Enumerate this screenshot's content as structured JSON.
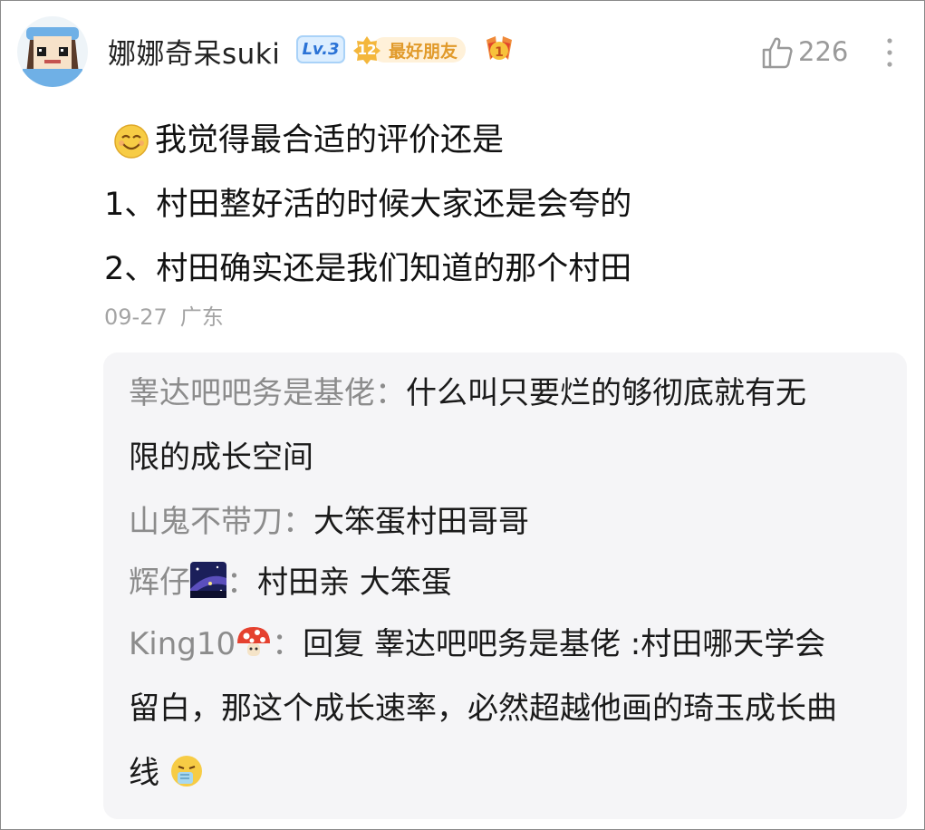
{
  "comment": {
    "author": "娜娜奇呆suki",
    "level_badge": "Lv.3",
    "friend_level": "12",
    "friend_label": "最好朋友",
    "medal_rank": "1",
    "like_count": "226",
    "lines": [
      "我觉得最合适的评价还是",
      "1、村田整好活的时候大家还是会夸的",
      "2、村田确实还是我们知道的那个村田"
    ],
    "date": "09-27",
    "location": "广东"
  },
  "replies": [
    {
      "author": "睾达吧吧务是基佬",
      "separator": "：",
      "line1": "什么叫只要烂的够彻底就有无",
      "line2": "限的成长空间"
    },
    {
      "author": "山鬼不带刀",
      "separator": "：",
      "text": "大笨蛋村田哥哥"
    },
    {
      "author": "辉仔",
      "separator": "：",
      "text": "村田亲 大笨蛋",
      "emoji": "galaxy-emoji"
    },
    {
      "author": "King10",
      "separator": "：",
      "emoji": "mushroom-emoji",
      "line1": "回复 睾达吧吧务是基佬 :村田哪天学会",
      "line2": "留白，那这个成长速率，必然超越他画的琦玉成长曲",
      "line3": "线"
    }
  ],
  "colors": {
    "author_gray": "#8c8c8c",
    "reply_bg": "#f5f5f7",
    "level_blue": "#2b73d6",
    "friend_orange": "#e19a2a"
  }
}
